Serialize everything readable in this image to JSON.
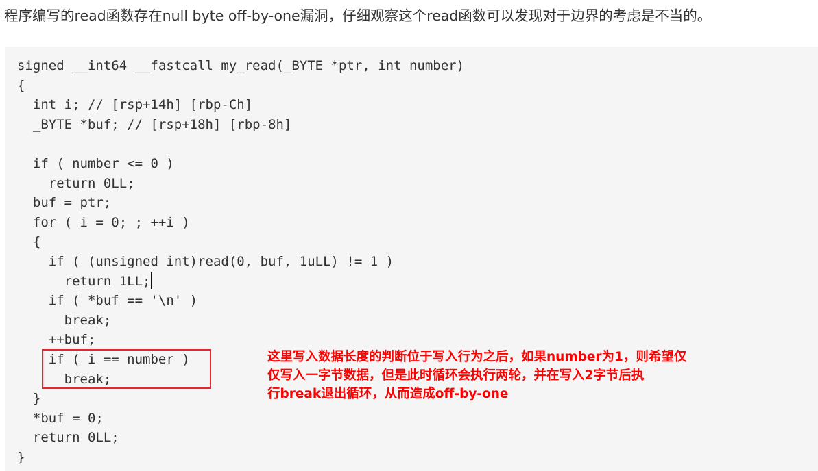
{
  "intro_text": "程序编写的read函数存在null byte off-by-one漏洞，仔细观察这个read函数可以发现对于边界的考虑是不当的。",
  "code": {
    "lines": [
      "signed __int64 __fastcall my_read(_BYTE *ptr, int number)",
      "{",
      "  int i; // [rsp+14h] [rbp-Ch]",
      "  _BYTE *buf; // [rsp+18h] [rbp-8h]",
      "",
      "  if ( number <= 0 )",
      "    return 0LL;",
      "  buf = ptr;",
      "  for ( i = 0; ; ++i )",
      "  {",
      "    if ( (unsigned int)read(0, buf, 1uLL) != 1 )",
      "      return 1LL;",
      "    if ( *buf == '\\n' )",
      "      break;",
      "    ++buf;",
      "    if ( i == number )",
      "      break;",
      "  }",
      "  *buf = 0;",
      "  return 0LL;",
      "}"
    ]
  },
  "annotation": {
    "lines": [
      "这里写入数据长度的判断位于写入行为之后，如果number为1，则希望仅",
      "仅写入一字节数据，但是此时循环会执行两轮，并在写入2字节后执",
      "行break退出循环，从而造成off-by-one"
    ]
  },
  "colors": {
    "code_background": "#f5f5f5",
    "code_text": "#333333",
    "annotation_text": "#ff0000",
    "highlight_border": "#e8242e"
  }
}
